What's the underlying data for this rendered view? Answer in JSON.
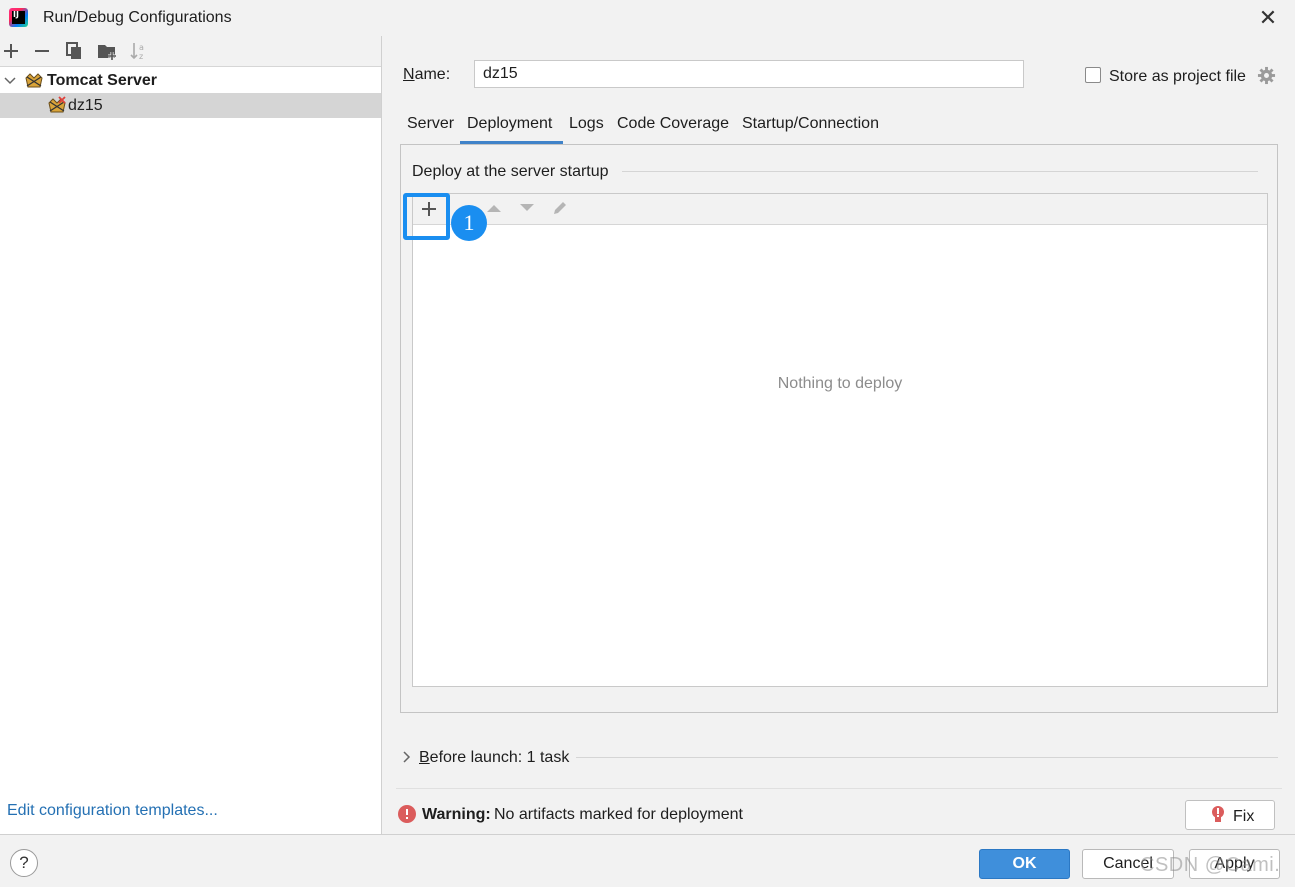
{
  "window": {
    "title": "Run/Debug Configurations",
    "app_icon": "intellij-idea-icon",
    "close_icon": "close-icon"
  },
  "sidebar": {
    "toolbar_icons": [
      "add-icon",
      "remove-icon",
      "copy-icon",
      "new-folder-icon",
      "sort-icon"
    ],
    "tree": {
      "group_label": "Tomcat Server",
      "expanded": true,
      "items": [
        {
          "label": "dz15",
          "selected": true
        }
      ]
    },
    "edit_templates_link": "Edit configuration templates..."
  },
  "config": {
    "name_label": "Name:",
    "name_value": "dz15",
    "store_as_project_file": {
      "label": "Store as project file",
      "checked": false
    },
    "tabs": [
      {
        "label": "Server",
        "active": false
      },
      {
        "label": "Deployment",
        "active": true
      },
      {
        "label": "Logs",
        "active": false
      },
      {
        "label": "Code Coverage",
        "active": false
      },
      {
        "label": "Startup/Connection",
        "active": false
      }
    ],
    "deploy_section": {
      "label": "Deploy at the server startup",
      "empty_text": "Nothing to deploy",
      "annotation_badge": "1"
    },
    "before_launch": "Before launch: 1 task",
    "warning": {
      "bold": "Warning:",
      "text": "No artifacts marked for deployment",
      "fix_label": "Fix"
    }
  },
  "footer": {
    "help_label": "?",
    "ok_label": "OK",
    "cancel_label": "Cancel",
    "apply_label": "Apply",
    "watermark": "CSDN @Cami."
  },
  "colors": {
    "accent": "#3f8fdb",
    "annotation": "#1a8ef0",
    "link": "#2470b3",
    "selection": "#d5d5d5",
    "warning": "#db5c5c"
  }
}
